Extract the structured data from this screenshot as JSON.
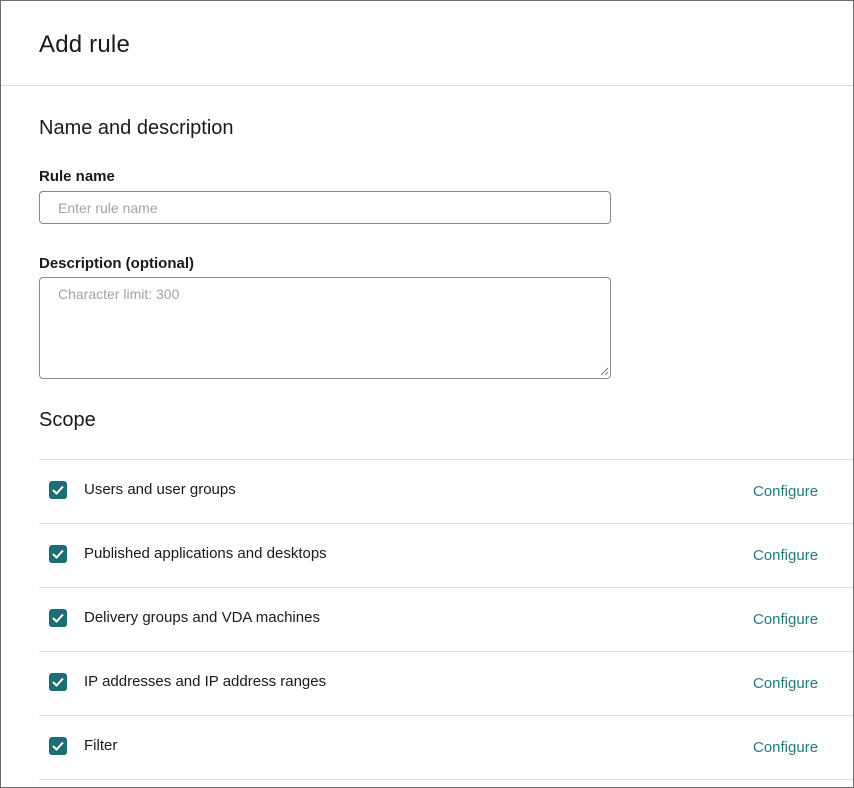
{
  "dialog": {
    "title": "Add rule"
  },
  "name_section": {
    "heading": "Name and description",
    "rule_name_label": "Rule name",
    "rule_name_value": "",
    "rule_name_placeholder": "Enter rule name",
    "description_label": "Description (optional)",
    "description_value": "",
    "description_placeholder": "Character limit: 300"
  },
  "scope": {
    "heading": "Scope",
    "items": [
      {
        "label": "Users and user groups",
        "checked": true,
        "action": "Configure"
      },
      {
        "label": "Published applications and desktops",
        "checked": true,
        "action": "Configure"
      },
      {
        "label": "Delivery groups and VDA machines",
        "checked": true,
        "action": "Configure"
      },
      {
        "label": "IP addresses and IP address ranges",
        "checked": true,
        "action": "Configure"
      },
      {
        "label": "Filter",
        "checked": true,
        "action": "Configure"
      }
    ]
  },
  "colors": {
    "accent": "#1f6d74",
    "link": "#1f7a80",
    "divider": "#dcdcdc"
  },
  "icons": {
    "checkbox_mark": "check-icon",
    "textarea_grip": "resize-grip-icon"
  }
}
